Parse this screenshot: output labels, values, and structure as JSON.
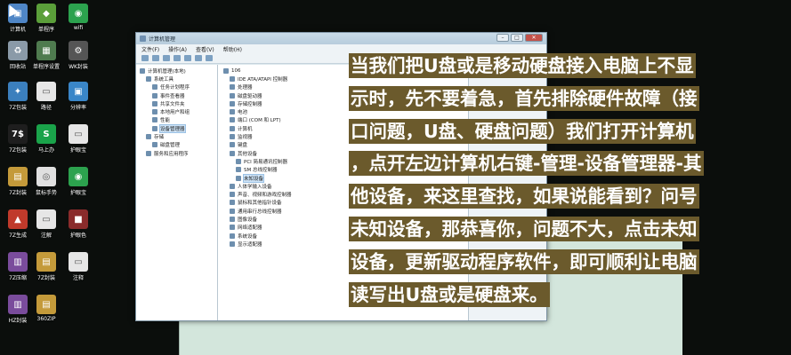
{
  "desktop": {
    "icons": [
      {
        "label": "计算机",
        "glyph": "▣",
        "color": "#4f86c6",
        "name": "computer-icon"
      },
      {
        "label": "单程序",
        "glyph": "◆",
        "color": "#5b9f3a",
        "name": "recycle-manager-icon"
      },
      {
        "label": "wifi",
        "glyph": "◉",
        "color": "#2ca24e",
        "name": "wifi-icon"
      },
      {
        "label": "回收站",
        "glyph": "♻",
        "color": "#8a9aa8",
        "name": "recycle-bin-icon"
      },
      {
        "label": "单程序设置",
        "glyph": "▦",
        "color": "#4f7b4f",
        "name": "program-settings-icon"
      },
      {
        "label": "WK封装",
        "glyph": "⚙",
        "color": "#555",
        "name": "wk-package-icon"
      },
      {
        "label": "7Z包装",
        "glyph": "✦",
        "color": "#3b7fbd",
        "name": "7z-package-icon"
      },
      {
        "label": "路径",
        "glyph": "▭",
        "color": "#e6e6e6",
        "name": "path-file-icon"
      },
      {
        "label": "分辨率",
        "glyph": "▣",
        "color": "#3a86c8",
        "name": "resolution-icon"
      },
      {
        "label": "7Z包装",
        "glyph": "7$",
        "color": "#1e1e1e",
        "name": "7z-sfx-icon"
      },
      {
        "label": "马上办",
        "glyph": "S",
        "color": "#1aa34a",
        "name": "mashangban-icon"
      },
      {
        "label": "护眼宝",
        "glyph": "▭",
        "color": "#e6e6e6",
        "name": "eye-care-file-icon"
      },
      {
        "label": "7Z封装",
        "glyph": "▤",
        "color": "#c49a3a",
        "name": "7z-seal-icon"
      },
      {
        "label": "鼠标手势",
        "glyph": "◎",
        "color": "#e0e0e0",
        "name": "mouse-gesture-icon"
      },
      {
        "label": "护眼宝",
        "glyph": "◉",
        "color": "#2ca24e",
        "name": "eye-care-icon"
      },
      {
        "label": "7Z生成",
        "glyph": "▲",
        "color": "#c03a2b",
        "name": "7z-generate-icon"
      },
      {
        "label": "注解",
        "glyph": "▭",
        "color": "#e6e6e6",
        "name": "note-file-icon"
      },
      {
        "label": "护眼色",
        "glyph": "■",
        "color": "#8a2b2b",
        "name": "eye-color-icon"
      },
      {
        "label": "7Z压缩",
        "glyph": "▥",
        "color": "#7a4c9c",
        "name": "7z-compress-icon"
      },
      {
        "label": "7Z封装",
        "glyph": "▤",
        "color": "#c49a3a",
        "name": "7z-seal-2-icon"
      },
      {
        "label": "注释",
        "glyph": "▭",
        "color": "#e6e6e6",
        "name": "comment-file-icon"
      },
      {
        "label": "HZ封装",
        "glyph": "▥",
        "color": "#7a4c9c",
        "name": "hz-package-icon"
      },
      {
        "label": "360ZIP",
        "glyph": "▤",
        "color": "#c49a3a",
        "name": "360zip-icon"
      }
    ]
  },
  "window": {
    "title": "计算机管理",
    "menu": [
      "文件(F)",
      "操作(A)",
      "查看(V)",
      "帮助(H)"
    ],
    "minimize": "–",
    "maximize": "□",
    "close": "✕"
  },
  "tree_left": [
    "计算机管理(本地)",
    "系统工具",
    "任务计划程序",
    "事件查看器",
    "共享文件夹",
    "本地用户和组",
    "性能",
    "设备管理器",
    "存储",
    "磁盘管理",
    "服务和应用程序"
  ],
  "tree_right": [
    "106",
    "IDE ATA/ATAPI 控制器",
    "处理器",
    "磁盘驱动器",
    "存储控制器",
    "电池",
    "端口 (COM 和 LPT)",
    "计算机",
    "监视器",
    "键盘",
    "其他设备",
    "PCI 简易通讯控制器",
    "SM 总线控制器",
    "未知设备",
    "人体学输入设备",
    "声音、视频和游戏控制器",
    "鼠标和其他指针设备",
    "通用串行总线控制器",
    "图像设备",
    "网络适配器",
    "系统设备",
    "显示适配器"
  ],
  "caption": [
    "当我们把U盘或是移动硬盘接入电脑上不显",
    "示时，先不要着急，首先排除硬件故障（接",
    "口问题，U盘、硬盘问题）我们打开计算机",
    "，点开左边计算机右键-管理-设备管理器-其",
    "他设备，来这里查找，如果说能看到？问号",
    "未知设备，那恭喜你，问题不大，点击未知",
    "设备，更新驱动程序软件，即可顺利让电脑",
    "读写出U盘或是硬盘来。"
  ]
}
